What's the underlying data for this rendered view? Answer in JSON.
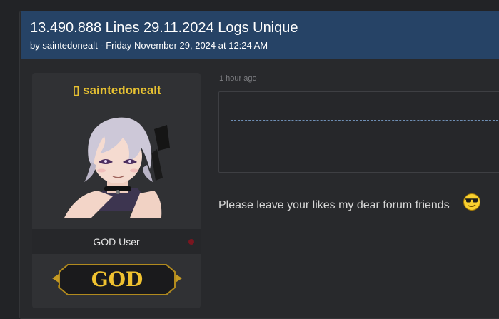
{
  "thread": {
    "title": "13.490.888 Lines 29.11.2024 Logs Unique",
    "meta": "by saintedonealt - Friday November 29, 2024 at 12:24 AM"
  },
  "user": {
    "glyph": "▯",
    "name": "saintedonealt",
    "role": "GOD User",
    "badge_text": "GOD",
    "status_color": "#7a1620"
  },
  "post": {
    "time": "1 hour ago",
    "message": "Please leave your likes my dear forum friends",
    "emoji": "smiley-sunglasses-icon"
  },
  "colors": {
    "header_bg": "#264366",
    "username": "#e8c232",
    "page_bg": "#222326"
  }
}
